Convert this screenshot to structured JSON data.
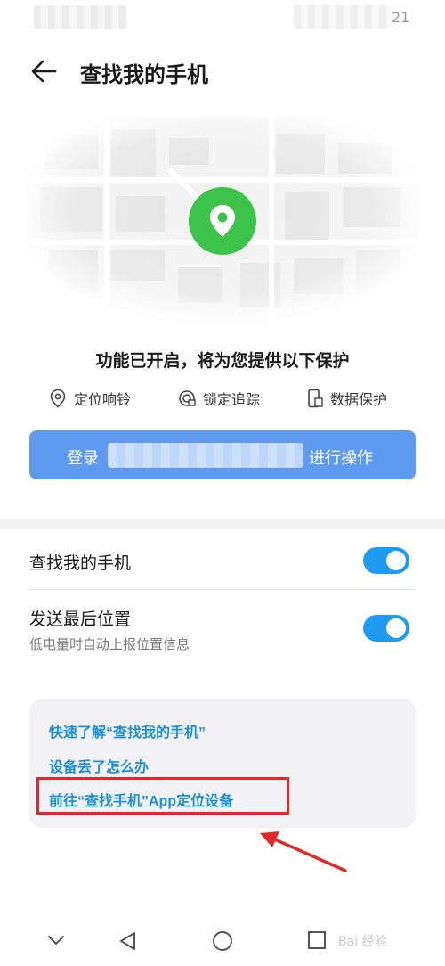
{
  "status_bar": {
    "time_fragment": "21"
  },
  "header": {
    "title": "查找我的手机",
    "back_icon": "arrow-left-icon"
  },
  "map": {
    "pin_icon": "location-pin-icon",
    "pin_color": "#3dc24a"
  },
  "protection": {
    "heading": "功能已开启，将为您提供以下保护",
    "features": [
      {
        "icon": "location-outline-icon",
        "label": "定位响铃"
      },
      {
        "icon": "lock-track-icon",
        "label": "锁定追踪"
      },
      {
        "icon": "phone-data-icon",
        "label": "数据保护"
      }
    ]
  },
  "login": {
    "prefix": "登录",
    "suffix": "进行操作",
    "color": "#5e9bf0"
  },
  "settings": [
    {
      "title": "查找我的手机",
      "subtitle": "",
      "enabled": true
    },
    {
      "title": "发送最后位置",
      "subtitle": "低电量时自动上报位置信息",
      "enabled": true
    }
  ],
  "toggle_color": "#1e9bf0",
  "help_links": [
    "快速了解“查找我的手机”",
    "设备丢了怎么办",
    "前往“查找手机”App定位设备"
  ],
  "link_color": "#1e8fd6",
  "annotation": {
    "box_color": "#e02a2a"
  },
  "nav": {
    "items": [
      "chevron-down-icon",
      "back-triangle-icon",
      "home-circle-icon",
      "recents-square-icon"
    ]
  },
  "watermark": "Bai 经验"
}
